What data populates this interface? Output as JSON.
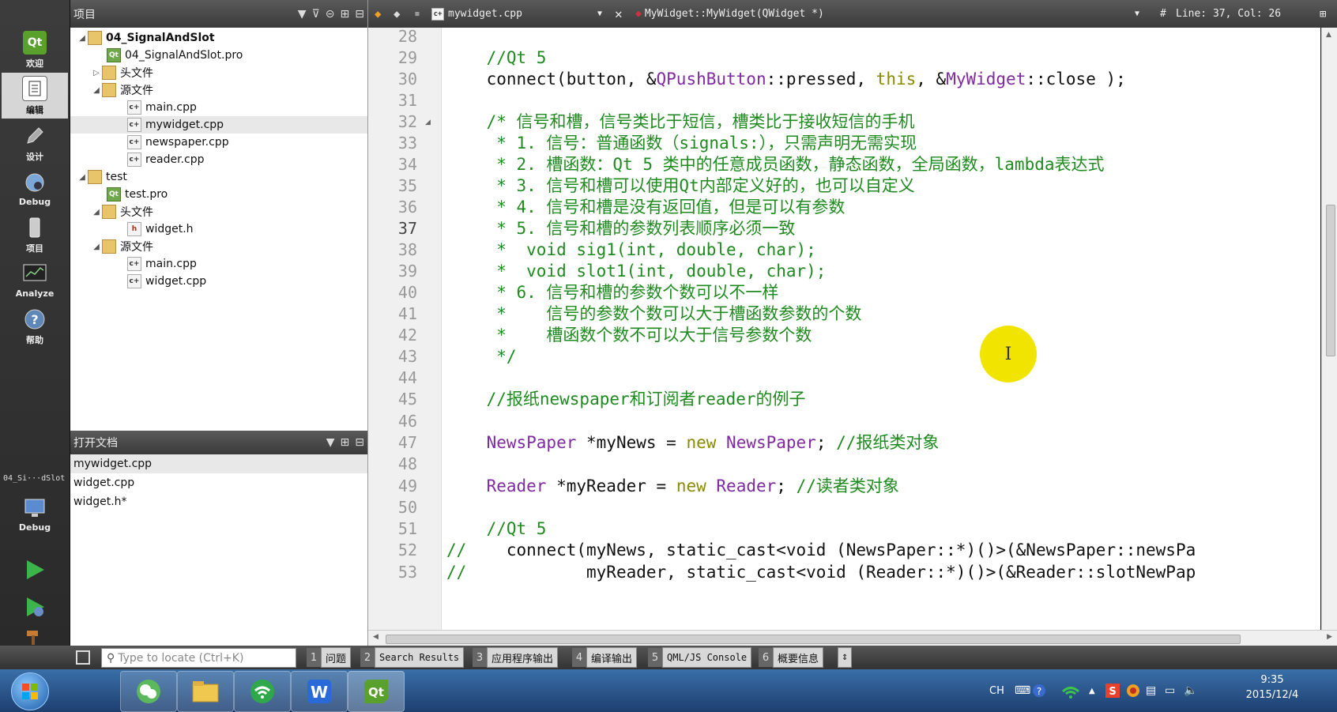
{
  "modes": [
    {
      "label": "欢迎",
      "icon": "qt-logo-icon"
    },
    {
      "label": "编辑",
      "icon": "edit-document-icon"
    },
    {
      "label": "设计",
      "icon": "design-pencil-icon"
    },
    {
      "label": "Debug",
      "icon": "debug-bug-icon"
    },
    {
      "label": "项目",
      "icon": "project-wrench-icon"
    },
    {
      "label": "Analyze",
      "icon": "analyze-monitor-icon"
    },
    {
      "label": "帮助",
      "icon": "help-question-icon"
    }
  ],
  "kit": {
    "project": "04_Si···dSlot",
    "mode": "Debug"
  },
  "project_pane": {
    "title": "项目",
    "tree": [
      {
        "label": "04_SignalAndSlot",
        "type": "project",
        "bold": true
      },
      {
        "label": "04_SignalAndSlot.pro",
        "type": "pro"
      },
      {
        "label": "头文件",
        "type": "folder"
      },
      {
        "label": "源文件",
        "type": "folder"
      },
      {
        "label": "main.cpp",
        "type": "cpp"
      },
      {
        "label": "mywidget.cpp",
        "type": "cpp",
        "selected": true
      },
      {
        "label": "newspaper.cpp",
        "type": "cpp"
      },
      {
        "label": "reader.cpp",
        "type": "cpp"
      },
      {
        "label": "test",
        "type": "project"
      },
      {
        "label": "test.pro",
        "type": "pro"
      },
      {
        "label": "头文件",
        "type": "folder"
      },
      {
        "label": "widget.h",
        "type": "h"
      },
      {
        "label": "源文件",
        "type": "folder"
      },
      {
        "label": "main.cpp",
        "type": "cpp"
      },
      {
        "label": "widget.cpp",
        "type": "cpp"
      }
    ]
  },
  "open_docs": {
    "title": "打开文档",
    "items": [
      "mywidget.cpp",
      "widget.cpp",
      "widget.h*"
    ]
  },
  "editor": {
    "file": "mywidget.cpp",
    "symbol": "MyWidget::MyWidget(QWidget *)",
    "position": "Line: 37, Col: 26",
    "hash": "#",
    "current_line": 37,
    "lines": [
      {
        "n": 28,
        "t": ""
      },
      {
        "n": 29,
        "t": "    //Qt 5"
      },
      {
        "n": 30,
        "t": "    connect(button, &QPushButton::pressed, this, &MyWidget::close );"
      },
      {
        "n": 31,
        "t": ""
      },
      {
        "n": 32,
        "t": "    /* 信号和槽，信号类比于短信，槽类比于接收短信的手机"
      },
      {
        "n": 33,
        "t": "     * 1. 信号：普通函数（signals:），只需声明无需实现"
      },
      {
        "n": 34,
        "t": "     * 2. 槽函数：Qt 5 类中的任意成员函数，静态函数，全局函数，lambda表达式"
      },
      {
        "n": 35,
        "t": "     * 3. 信号和槽可以使用Qt内部定义好的，也可以自定义"
      },
      {
        "n": 36,
        "t": "     * 4. 信号和槽是没有返回值，但是可以有参数"
      },
      {
        "n": 37,
        "t": "     * 5. 信号和槽的参数列表顺序必须一致"
      },
      {
        "n": 38,
        "t": "     *  void sig1(int, double, char);"
      },
      {
        "n": 39,
        "t": "     *  void slot1(int, double, char);"
      },
      {
        "n": 40,
        "t": "     * 6. 信号和槽的参数个数可以不一样"
      },
      {
        "n": 41,
        "t": "     *    信号的参数个数可以大于槽函数参数的个数"
      },
      {
        "n": 42,
        "t": "     *    槽函数个数不可以大于信号参数个数"
      },
      {
        "n": 43,
        "t": "     */"
      },
      {
        "n": 44,
        "t": ""
      },
      {
        "n": 45,
        "t": "    //报纸newspaper和订阅者reader的例子"
      },
      {
        "n": 46,
        "t": ""
      },
      {
        "n": 47,
        "t": "    NewsPaper *myNews = new NewsPaper; //报纸类对象"
      },
      {
        "n": 48,
        "t": ""
      },
      {
        "n": 49,
        "t": "    Reader *myReader = new Reader; //读者类对象"
      },
      {
        "n": 50,
        "t": ""
      },
      {
        "n": 51,
        "t": "    //Qt 5"
      },
      {
        "n": 52,
        "t": "//    connect(myNews, static_cast<void (NewsPaper::*)()>(&NewsPaper::newsPa"
      },
      {
        "n": 53,
        "t": "//            myReader, static_cast<void (Reader::*)()>(&Reader::slotNewPap"
      }
    ]
  },
  "locator": {
    "placeholder": "Type to locate (Ctrl+K)"
  },
  "output_panes": [
    {
      "num": "1",
      "label": "问题"
    },
    {
      "num": "2",
      "label": "Search Results"
    },
    {
      "num": "3",
      "label": "应用程序输出"
    },
    {
      "num": "4",
      "label": "编译输出"
    },
    {
      "num": "5",
      "label": "QML/JS Console"
    },
    {
      "num": "6",
      "label": "概要信息"
    }
  ],
  "taskbar": {
    "lang": "CH",
    "time": "9:35",
    "date": "2015/12/4",
    "apps": [
      "start-orb-icon",
      "wechat-icon",
      "explorer-folder-icon",
      "wifi-app-icon",
      "wps-writer-icon",
      "qt-creator-icon"
    ]
  },
  "colors": {
    "comment": "#1f8a1f",
    "keyword": "#8a8a00",
    "type": "#7f2aa0",
    "cursor_highlight": "#f0e400"
  }
}
